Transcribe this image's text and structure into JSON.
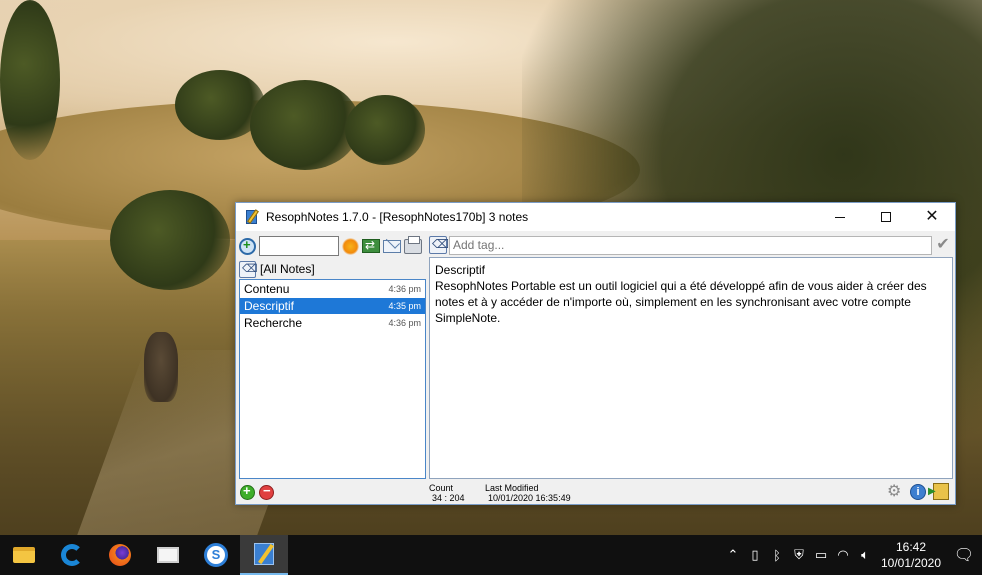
{
  "window": {
    "title": "ResophNotes 1.7.0 - [ResophNotes170b] 3 notes"
  },
  "toolbar": {
    "search_value": ""
  },
  "tags": {
    "placeholder": "Add tag..."
  },
  "notebook": {
    "label": "[All Notes]"
  },
  "notes": [
    {
      "title": "Contenu",
      "time": "4:36 pm"
    },
    {
      "title": "Descriptif",
      "time": "4:35 pm"
    },
    {
      "title": "Recherche",
      "time": "4:36 pm"
    }
  ],
  "editor": {
    "heading": "Descriptif",
    "body": "ResophNotes Portable est un outil logiciel qui a été développé afin de vous aider à créer des notes et à y accéder de n'importe où, simplement en les synchronisant avec votre compte SimpleNote."
  },
  "status": {
    "count_label": "Count",
    "count_value": "34 : 204",
    "modified_label": "Last Modified",
    "modified_value": "10/01/2020 16:35:49"
  },
  "taskbar": {
    "time": "16:42",
    "date": "10/01/2020"
  }
}
